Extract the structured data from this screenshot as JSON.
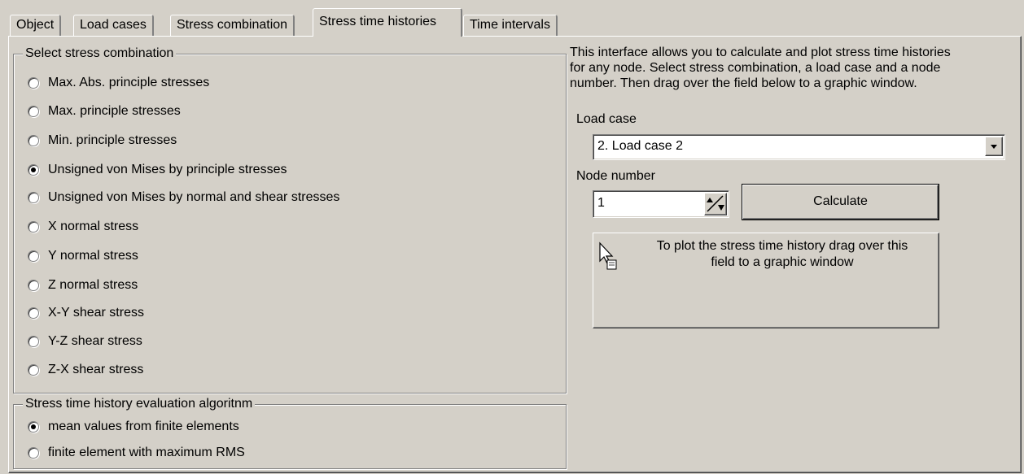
{
  "tabs": [
    {
      "label": "Object"
    },
    {
      "label": "Load cases"
    },
    {
      "label": "Stress combination"
    },
    {
      "label": "Stress time histories"
    },
    {
      "label": "Time intervals"
    }
  ],
  "stress_combination": {
    "title": "Select stress combination",
    "options": [
      {
        "label": "Max. Abs. principle stresses",
        "checked": false
      },
      {
        "label": "Max. principle stresses",
        "checked": false
      },
      {
        "label": "Min. principle stresses",
        "checked": false
      },
      {
        "label": "Unsigned von Mises by principle stresses",
        "checked": true
      },
      {
        "label": "Unsigned von Mises by normal and shear stresses",
        "checked": false
      },
      {
        "label": "X normal stress",
        "checked": false
      },
      {
        "label": "Y normal stress",
        "checked": false
      },
      {
        "label": "Z normal stress",
        "checked": false
      },
      {
        "label": "X-Y shear stress",
        "checked": false
      },
      {
        "label": "Y-Z shear stress",
        "checked": false
      },
      {
        "label": "Z-X shear stress",
        "checked": false
      }
    ]
  },
  "algorithm": {
    "title": "Stress time history evaluation algoritnm",
    "options": [
      {
        "label": "mean values from finite elements",
        "checked": true
      },
      {
        "label": "finite element with maximum RMS",
        "checked": false
      }
    ]
  },
  "info": {
    "line1": "This interface allows you to calculate and plot stress time histories",
    "line2": "for any node. Select stress combination, a load case and a node",
    "line3": "number. Then drag over the field below to a graphic window."
  },
  "load_case": {
    "label": "Load case",
    "value": "2. Load case 2"
  },
  "node": {
    "label": "Node number",
    "value": "1"
  },
  "calculate_label": "Calculate",
  "drag_field": {
    "line1": "To plot the stress time history drag over this",
    "line2": "field to a graphic window"
  }
}
